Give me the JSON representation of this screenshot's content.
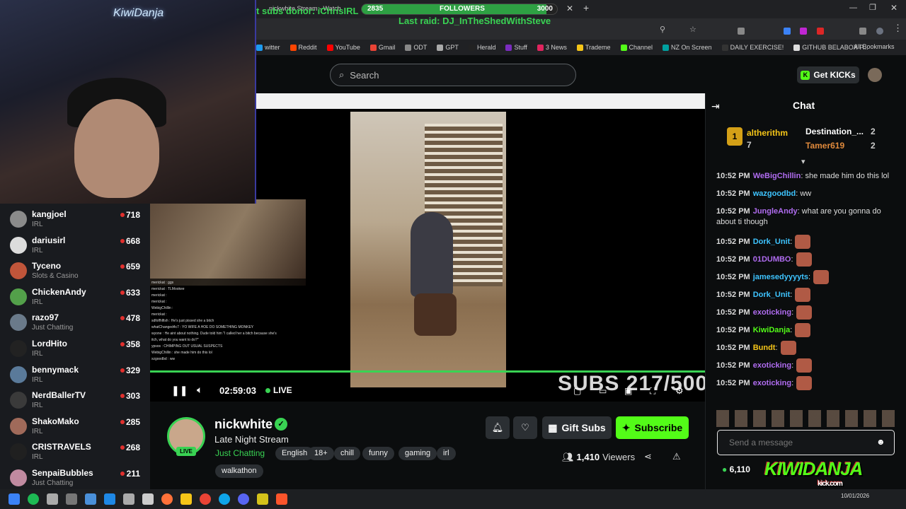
{
  "overlay": {
    "subs_donor": "t subs donor: iChrisIRL",
    "followers_current": "2835",
    "followers_label": "FOLLOWERS",
    "followers_goal": "3000",
    "followers_progress": 0.945,
    "last_raid": "Last raid: DJ_InTheShedWithSteve",
    "tab_title": "nickwhite Stream - Watch"
  },
  "bookmarks": [
    {
      "label": "witter",
      "color": "#1d9bf0"
    },
    {
      "label": "Reddit",
      "color": "#ff4500"
    },
    {
      "label": "YouTube",
      "color": "#ff0000"
    },
    {
      "label": "Gmail",
      "color": "#ea4335"
    },
    {
      "label": "ODT",
      "color": "#888888"
    },
    {
      "label": "GPT",
      "color": "#aaaaaa"
    },
    {
      "label": "Herald",
      "color": "#222222"
    },
    {
      "label": "Stuff",
      "color": "#7b2cbf"
    },
    {
      "label": "3 News",
      "color": "#e0245e"
    },
    {
      "label": "Trademe",
      "color": "#f5c518"
    },
    {
      "label": "Channel",
      "color": "#53fc18"
    },
    {
      "label": "NZ On Screen",
      "color": "#00a0a0"
    },
    {
      "label": "DAILY EXERCISE!",
      "color": "#333333"
    },
    {
      "label": "GITHUB BELABOX P...",
      "color": "#dddddd"
    }
  ],
  "all_bookmarks": "All Bookmarks",
  "header": {
    "search_placeholder": "Search",
    "get_kicks": "Get KICKs"
  },
  "webcam": {
    "neon_text": "KiwiDanja"
  },
  "sidebar": {
    "items": [
      {
        "name": "kangjoel",
        "category": "IRL",
        "viewers": "718",
        "avatar": "#8b8b8b"
      },
      {
        "name": "dariusirl",
        "category": "IRL",
        "viewers": "668",
        "avatar": "#dcdcdc"
      },
      {
        "name": "Tyceno",
        "category": "Slots & Casino",
        "viewers": "659",
        "avatar": "#c0553a"
      },
      {
        "name": "ChickenAndy",
        "category": "IRL",
        "viewers": "633",
        "avatar": "#53a04a"
      },
      {
        "name": "razo97",
        "category": "Just Chatting",
        "viewers": "478",
        "avatar": "#6a7a8a"
      },
      {
        "name": "LordHito",
        "category": "IRL",
        "viewers": "358",
        "avatar": "#222222"
      },
      {
        "name": "bennymack",
        "category": "IRL",
        "viewers": "329",
        "avatar": "#5a7a9a"
      },
      {
        "name": "NerdBallerTV",
        "category": "IRL",
        "viewers": "303",
        "avatar": "#3a3a3a"
      },
      {
        "name": "ShakoMako",
        "category": "IRL",
        "viewers": "285",
        "avatar": "#a06a5a"
      },
      {
        "name": "CRISTRAVELS",
        "category": "IRL",
        "viewers": "268",
        "avatar": "#202020"
      },
      {
        "name": "SenpaiBubbles",
        "category": "Just Chatting",
        "viewers": "211",
        "avatar": "#c08aa0"
      }
    ]
  },
  "player": {
    "time": "02:59:03",
    "live": "LIVE",
    "subs_overlay": "SUBS 217/500",
    "pip_chat": [
      "merickat : ggs",
      "merickat : TLMookee",
      "merickat :",
      "merickat :",
      "WebigChillin :",
      "merickat :",
      "sdfolfhlfish : He's just pissed she a bitch",
      "whatChanged4c7 : YO WIFE A HOE DO SOMETHING MONKEY",
      "wyone : He aint about nothing. Dude told him \"I called her a bitch because she's",
      "itch, what do you want to do?\"",
      "ypsos : CHIMPING OUT USUAL SUSPECTS",
      "WebigChillin : she made him do this lol",
      "xzgoodbd : ww"
    ]
  },
  "channel": {
    "name": "nickwhite",
    "title": "Late Night Stream",
    "category": "Just Chatting",
    "tags": [
      "English",
      "18+",
      "chill",
      "funny",
      "gaming",
      "irl",
      "walkathon"
    ],
    "live_badge": "LIVE",
    "gift_subs": "Gift Subs",
    "subscribe": "Subscribe",
    "viewers_count": "1,410",
    "viewers_label": "Viewers"
  },
  "chat": {
    "title": "Chat",
    "leaderboard": [
      {
        "rank": "1",
        "name": "altherithm",
        "count": "7"
      },
      {
        "name": "Destination_...",
        "count": "2"
      },
      {
        "name": "Tamer619",
        "count": "2"
      }
    ],
    "messages": [
      {
        "time": "10:52 PM",
        "user": "WeBigChillin",
        "color": "#b06cf0",
        "text": ": she made him do this lol"
      },
      {
        "time": "10:52 PM",
        "user": "wazgoodbd",
        "color": "#3ec4ff",
        "text": ": ww"
      },
      {
        "time": "10:52 PM",
        "user": "JungleAndy",
        "color": "#b06cf0",
        "text": ": what are you gonna do about ti though"
      },
      {
        "time": "10:52 PM",
        "user": "Dork_Unit",
        "color": "#3ec4ff",
        "text": ":",
        "emote": true
      },
      {
        "time": "10:52 PM",
        "user": "01DUMBO",
        "color": "#b06cf0",
        "text": ":",
        "emote": true
      },
      {
        "time": "10:52 PM",
        "user": "jamesedyyyyts",
        "color": "#3ec4ff",
        "text": ":",
        "emote": true
      },
      {
        "time": "10:52 PM",
        "user": "Dork_Unit",
        "color": "#3ec4ff",
        "text": ":",
        "emote": true
      },
      {
        "time": "10:52 PM",
        "user": "exoticking",
        "color": "#b06cf0",
        "text": ":",
        "emote": true
      },
      {
        "time": "10:52 PM",
        "user": "KiwiDanja",
        "color": "#53fc18",
        "text": ":",
        "emote": true
      },
      {
        "time": "10:52 PM",
        "user": "Bundt",
        "color": "#f5c518",
        "text": ":",
        "emote": true
      },
      {
        "time": "10:52 PM",
        "user": "exoticking",
        "color": "#b06cf0",
        "text": ":",
        "emote": true
      },
      {
        "time": "10:52 PM",
        "user": "exoticking",
        "color": "#b06cf0",
        "text": ":",
        "emote": true
      }
    ],
    "input_placeholder": "Send a message",
    "points": "6,110",
    "logo_text": "KIWIDANJA",
    "logo_sub": "kick.com"
  },
  "taskbar": {
    "date": "10/01/2026"
  }
}
